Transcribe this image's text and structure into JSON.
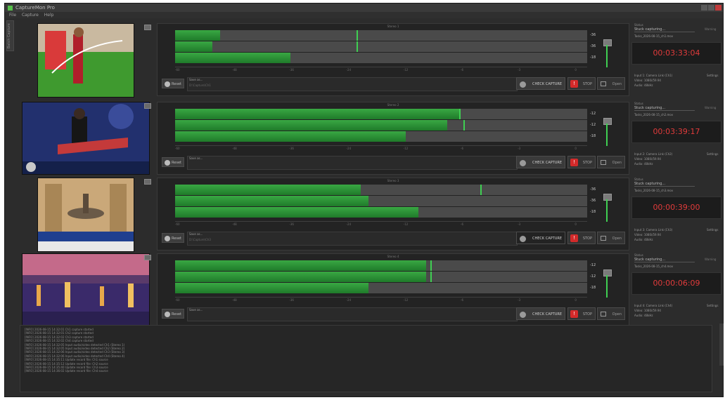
{
  "window": {
    "title": "CaptureMon Pro",
    "menu": [
      "File",
      "Capture",
      "Help"
    ],
    "sidetab": "Batch Capture"
  },
  "colors": {
    "meter_green": "#39a843",
    "timer_red": "#e13b3b",
    "stop_red": "#d32a2a"
  },
  "channels": [
    {
      "group": "Stereo 1",
      "meters": [
        {
          "level": 0.11,
          "peak": 0.44,
          "db": "-36"
        },
        {
          "level": 0.09,
          "peak": 0.44,
          "db": "-36"
        },
        {
          "level": 0.28,
          "peak": null,
          "db": "-18"
        }
      ],
      "scale": [
        "-60",
        "-48",
        "-36",
        "-24",
        "-12",
        "-6",
        "-3",
        "0"
      ],
      "reset": "Reset",
      "save_label": "Save as...",
      "save_path": "D:\\Capture\\Ch1",
      "check": "CHECK CAPTURE",
      "stop": "STOP",
      "open": "Open",
      "status_label": "Status",
      "state": "Stuck capturing...",
      "state2": "Warning",
      "file": "Tasks_2026-08-15_ch1.mov",
      "timer": "00:03:33:04",
      "info": [
        "Input 1: Camera Link (Ch1)",
        "Video: 1080i/59.94",
        "Audio: 48kHz"
      ],
      "info_right": "Settings"
    },
    {
      "group": "Stereo 2",
      "meters": [
        {
          "level": 0.69,
          "peak": 0.69,
          "db": "-12"
        },
        {
          "level": 0.66,
          "peak": 0.7,
          "db": "-12"
        },
        {
          "level": 0.56,
          "peak": null,
          "db": "-18"
        }
      ],
      "scale": [
        "-60",
        "-48",
        "-36",
        "-24",
        "-12",
        "-6",
        "-3",
        "0"
      ],
      "reset": "Reset",
      "save_label": "Save as...",
      "save_path": "",
      "check": "CHECK CAPTURE",
      "stop": "STOP",
      "open": "Open",
      "status_label": "Status",
      "state": "Stuck capturing...",
      "state2": "Warning",
      "file": "Tasks_2026-08-15_ch2.mov",
      "timer": "00:03:39:17",
      "info": [
        "Input 2: Camera Link (Ch2)",
        "Video: 1080i/59.94",
        "Audio: 48kHz"
      ],
      "info_right": "Settings"
    },
    {
      "group": "Stereo 3",
      "meters": [
        {
          "level": 0.45,
          "peak": 0.74,
          "db": "-36"
        },
        {
          "level": 0.47,
          "peak": null,
          "db": "-36"
        },
        {
          "level": 0.59,
          "peak": null,
          "db": "-18"
        }
      ],
      "scale": [
        "-60",
        "-48",
        "-36",
        "-24",
        "-12",
        "-6",
        "-3",
        "0"
      ],
      "reset": "Reset",
      "save_label": "Save as...",
      "save_path": "D:\\Capture\\Ch3",
      "check": "CHECK CAPTURE",
      "stop": "STOP",
      "open": "Open",
      "status_label": "Status",
      "state": "Stuck capturing...",
      "state2": "",
      "file": "Tasks_2026-08-15_ch3.mov",
      "timer": "00:00:39:00",
      "info": [
        "Input 3: Camera Link (Ch3)",
        "Video: 1080i/59.94",
        "Audio: 48kHz"
      ],
      "info_right": "Settings"
    },
    {
      "group": "Stereo 4",
      "meters": [
        {
          "level": 0.61,
          "peak": 0.62,
          "db": "-12"
        },
        {
          "level": 0.61,
          "peak": 0.62,
          "db": "-12"
        },
        {
          "level": 0.47,
          "peak": null,
          "db": "-18"
        }
      ],
      "scale": [
        "-60",
        "-48",
        "-36",
        "-24",
        "-12",
        "-6",
        "-3",
        "0"
      ],
      "reset": "Reset",
      "save_label": "Save as...",
      "save_path": "",
      "check": "CHECK CAPTURE",
      "stop": "STOP",
      "open": "Open",
      "status_label": "Status",
      "state": "Stuck capturing...",
      "state2": "Warning",
      "file": "Tasks_2026-08-15_ch4.mov",
      "timer": "00:00:06:09",
      "info": [
        "Input 4: Camera Link (Ch4)",
        "Video: 1080i/59.94",
        "Audio: 48kHz"
      ],
      "info_right": "Settings"
    }
  ],
  "log": [
    "[INFO] 2026-08-15 14:32:01  Ch1 capture started",
    "[INFO] 2026-08-15 14:32:01  Ch2 capture started",
    "[INFO] 2026-08-15 14:32:02  Ch3 capture started",
    "[INFO] 2026-08-15 14:32:02  Ch4 capture started",
    "[INFO] 2026-08-15 14:32:05  Input audio/video detected Ch1 (Stereo 1)",
    "[INFO] 2026-08-15 14:32:05  Input audio/video detected Ch2 (Stereo 2)",
    "[INFO] 2026-08-15 14:32:06  Input audio/video detected Ch3 (Stereo 3)",
    "[INFO] 2026-08-15 14:32:06  Input audio/video detected Ch4 (Stereo 4)",
    "[INFO] 2026-08-15 14:35:11  Update record file: Ch1 source",
    "[INFO] 2026-08-15 14:35:12  Update record file: Ch2 source",
    "[INFO] 2026-08-15 14:35:40  Update record file: Ch3 source",
    "[INFO] 2026-08-15 14:36:02  Update record file: Ch4 source"
  ]
}
